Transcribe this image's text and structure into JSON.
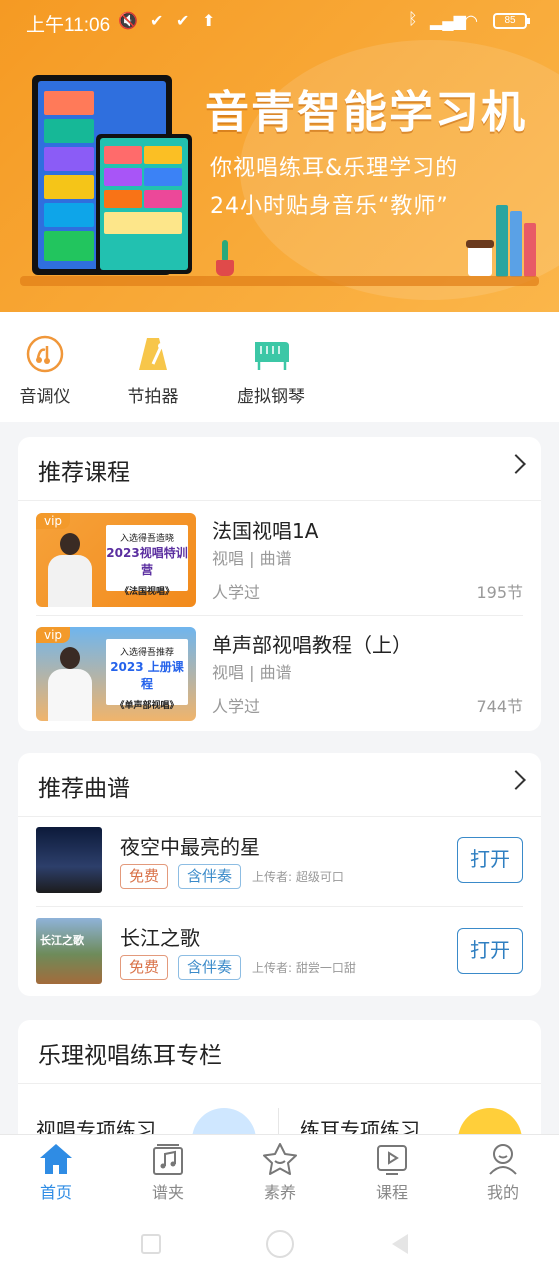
{
  "status_bar": {
    "time": "上午11:06",
    "battery": "85"
  },
  "banner": {
    "title": "音青智能学习机",
    "subtitle_line1": "你视唱练耳&乐理学习的",
    "subtitle_line2": "24小时贴身音乐“教师”"
  },
  "tools": [
    {
      "label": "音调仪",
      "icon": "tuner-icon"
    },
    {
      "label": "节拍器",
      "icon": "metronome-icon"
    },
    {
      "label": "虚拟钢琴",
      "icon": "piano-icon"
    }
  ],
  "recommended_courses": {
    "heading": "推荐课程",
    "items": [
      {
        "title": "法国视唱1A",
        "category": "视唱 | 曲谱",
        "learners": "人学过",
        "lessons": "195节",
        "badge": "vip",
        "poster_top": "入选得吾造晓",
        "poster_year": "2023视唱特训营",
        "poster_name": "《法国视唱》"
      },
      {
        "title": "单声部视唱教程（上）",
        "category": "视唱 | 曲谱",
        "learners": "人学过",
        "lessons": "744节",
        "badge": "vip",
        "poster_top": "入选得吾推荐",
        "poster_year": "2023 上册课程",
        "poster_name": "《单声部视唱》"
      }
    ]
  },
  "recommended_scores": {
    "heading": "推荐曲谱",
    "items": [
      {
        "title": "夜空中最亮的星",
        "tag_free": "免费",
        "tag_accomp": "含伴奏",
        "uploader": "上传者: 超级可口",
        "action": "打开"
      },
      {
        "title": "长江之歌",
        "tag_free": "免费",
        "tag_accomp": "含伴奏",
        "uploader": "上传者: 甜尝一口甜",
        "action": "打开",
        "thumb_text": "长江之歌"
      }
    ]
  },
  "column": {
    "heading": "乐理视唱练耳专栏",
    "item1": "视唱专项练习",
    "item2": "练耳专项练习"
  },
  "tabbar": [
    {
      "label": "首页",
      "icon": "home-icon",
      "active": true
    },
    {
      "label": "谱夹",
      "icon": "music-folder-icon"
    },
    {
      "label": "素养",
      "icon": "star-icon"
    },
    {
      "label": "课程",
      "icon": "video-course-icon"
    },
    {
      "label": "我的",
      "icon": "profile-icon"
    }
  ],
  "colors": {
    "accent": "#2f8ce4",
    "banner": "#f59a23",
    "free_tag": "#d9734a",
    "accomp_tag": "#3a8ac9"
  }
}
